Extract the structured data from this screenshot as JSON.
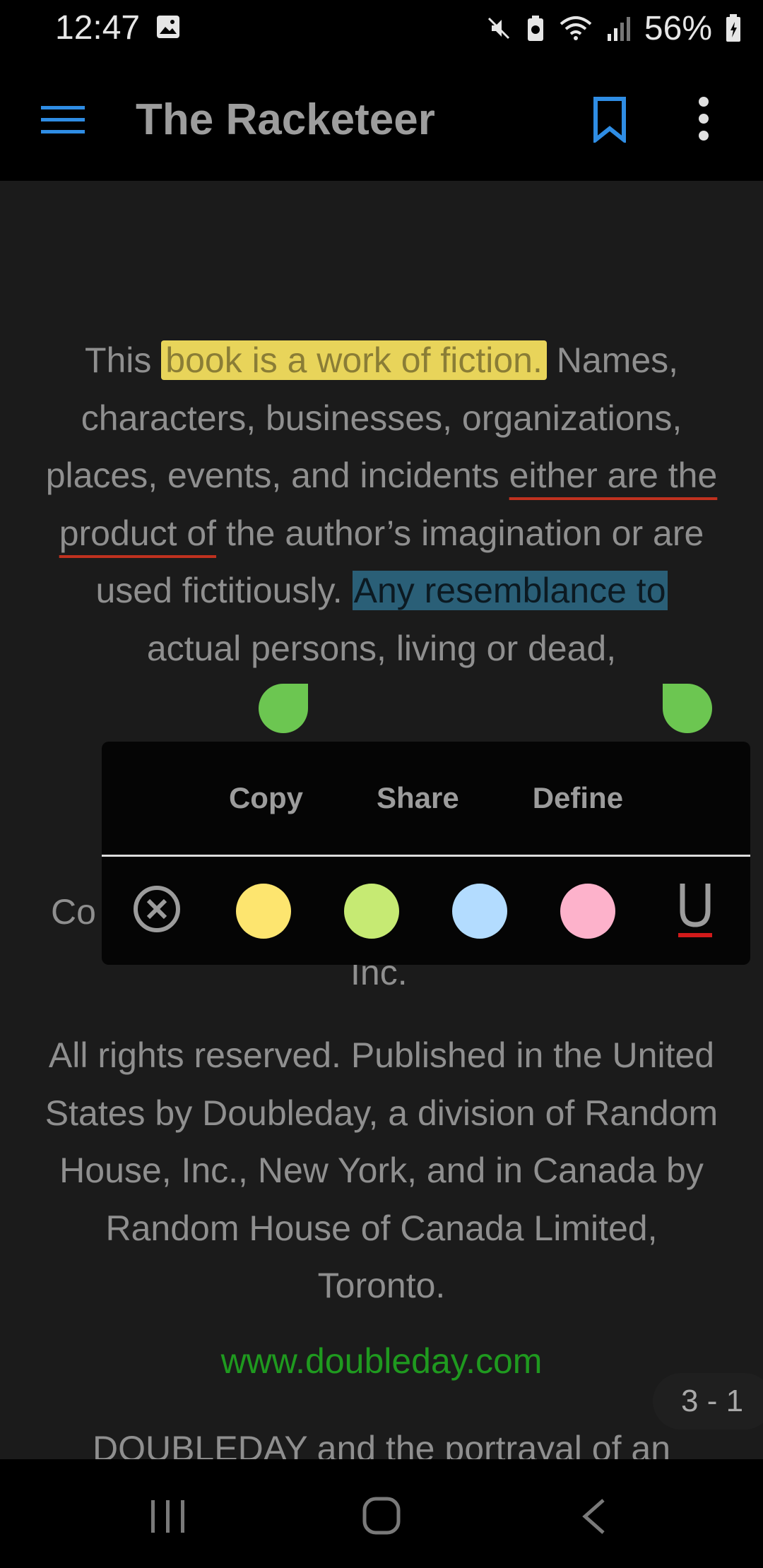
{
  "status_bar": {
    "time": "12:47",
    "battery": "56%"
  },
  "app_bar": {
    "title": "The Racketeer"
  },
  "content": {
    "para1": {
      "t1": "This ",
      "highlight_yellow": "book is a work of fiction.",
      "t2": " Names, characters, businesses, organizations, places, events, and incidents ",
      "underline_red": "either are the product of",
      "t3": " the author’s imagination or are used fictitiously. ",
      "selected": "Any resemblance to",
      "t4": " actual persons, living or dead,"
    },
    "partial_left": "Co",
    "partial_inc": "Inc.",
    "para2": "All rights reserved. Published in the United States by Doubleday, a division of Random House, Inc., New York, and in Canada by Random House of Canada Limited, Toronto.",
    "link": "www.doubleday.com",
    "para3": "DOUBLEDAY and the portrayal of an"
  },
  "popup": {
    "copy": "Copy",
    "share": "Share",
    "define": "Define",
    "colors": {
      "yellow": "#fde56f",
      "green": "#c6ea73",
      "blue": "#b3dcff",
      "pink": "#fdb2cb"
    }
  },
  "page_indicator": "3 - 1"
}
